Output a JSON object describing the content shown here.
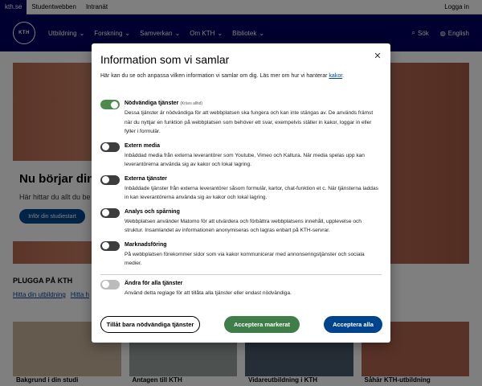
{
  "topbar": {
    "links": [
      "kth.se",
      "Studentwebben",
      "Intranät"
    ],
    "login": "Logga in"
  },
  "mainnav": {
    "logo_text": "KTH",
    "items": [
      "Utbildning",
      "Forskning",
      "Samverkan",
      "Om KTH",
      "Bibliotek"
    ],
    "search": "Sök",
    "language": "English"
  },
  "hero": {
    "title": "Nu börjar din t",
    "subtitle": "Här hittar du allt du be",
    "button": "Inför din studiestart"
  },
  "section": {
    "title": "PLUGGA PÅ KTH",
    "links": [
      "Hitta din utbildning",
      "Hitta h"
    ]
  },
  "cards": [
    "Bakgrund i din studi",
    "Antagen till KTH",
    "Vidareutbildning i KTH",
    "Såhär KTH-utbildning"
  ],
  "modal": {
    "title": "Information som vi samlar",
    "intro_text": "Här kan du se och anpassa vilken information vi samlar om dig. Läs mer om hur vi hanterar",
    "intro_link": "kakor",
    "intro_end": ".",
    "options": [
      {
        "title": "Nödvändiga tjänster",
        "required_note": "(Krävs alltid)",
        "desc": "Dessa tjänster är nödvändiga för att webbplatsen ska fungera och kan inte stängas av. De används främst när du nyttjar en funktion på webbplatsen som behöver ett svar, exempelvis ställer in kakor, loggar in eller fyller i formulär.",
        "state": "on"
      },
      {
        "title": "Extern media",
        "desc": "Inbäddad media från externa leverantörer som Youtube, Vimeo och Kaltura. När media spelas upp kan leverantörerna använda sig av kakor och lokal lagring.",
        "state": "off"
      },
      {
        "title": "Externa tjänster",
        "desc": "Inbäddade tjänster från externa leverantörer såsom formulär, kartor, chat-funktion et c. När tjänsterna laddas in kan leverantörerna använda sig av kakor och lokal lagring.",
        "state": "off"
      },
      {
        "title": "Analys och spårning",
        "desc": "Webbplatsen använder Matomo för att utvärdera och förbättra webbplatsens innehåll, upplevelse och struktur. Insamlandet av informationen anonymiseras och lagras enbart på KTH-servrar.",
        "state": "off"
      },
      {
        "title": "Marknadsföring",
        "desc": "På webbplatsen förekommer sidor som via kakor kommunicerar med annonseringstjänster och sociala medier.",
        "state": "off"
      }
    ],
    "all_toggle": {
      "title": "Ändra för alla tjänster",
      "desc": "Använd detta reglage för att tillåta alla tjänster eller endast nödvändiga.",
      "state": "off"
    },
    "buttons": {
      "necessary": "Tillåt bara nödvändiga tjänster",
      "selected": "Acceptera markerat",
      "all": "Acceptera alla"
    }
  },
  "colors": {
    "brand_navy": "#000061",
    "toggle_on": "#4d8a4e",
    "toggle_off": "#3d3d3d",
    "accept_selected": "#3f7d49",
    "accept_all": "#00448e",
    "link": "#004791"
  },
  "icons": [
    "chevron-down-icon",
    "search-icon",
    "globe-icon",
    "close-icon"
  ]
}
